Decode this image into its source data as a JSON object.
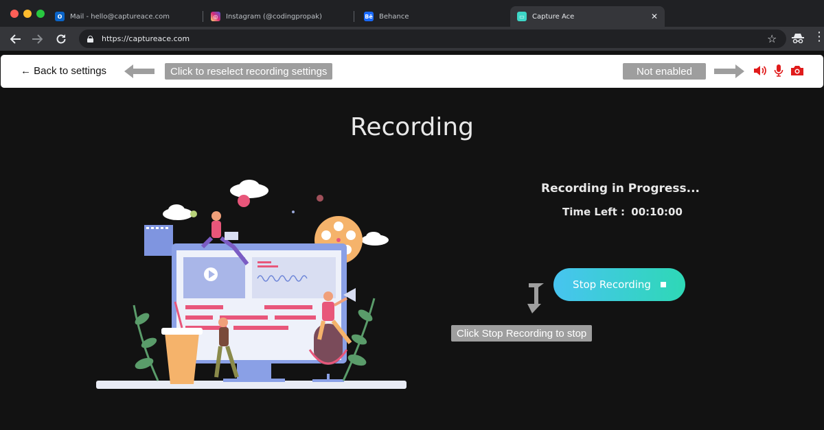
{
  "browser": {
    "tabs": [
      {
        "label": "Mail - hello@captureace.com",
        "favicon": "outlook-icon",
        "color": "#0a64c8"
      },
      {
        "label": "Instagram (@codingpropak)",
        "favicon": "instagram-icon",
        "color": "#d62976"
      },
      {
        "label": "Behance",
        "favicon": "behance-icon",
        "color": "#1769ff"
      },
      {
        "label": "Capture Ace",
        "favicon": "captureace-icon",
        "color": "#3dd6c6",
        "active": true
      }
    ],
    "url": "https://captureace.com"
  },
  "appbar": {
    "back_label": "← Back to settings",
    "reselect_hint": "Click to reselect recording settings",
    "not_enabled_hint": "Not enabled",
    "status_icons": [
      "speaker-icon",
      "microphone-icon",
      "camera-icon"
    ],
    "status_color": "#e01b1b"
  },
  "main": {
    "title": "Recording",
    "progress_text": "Recording in Progress...",
    "time_left_label": "Time Left :",
    "time_left_value": "00:10:00",
    "stop_label": "Stop Recording",
    "stop_hint": "Click Stop Recording to stop"
  },
  "colors": {
    "accent_start": "#47c4f0",
    "accent_end": "#2ed8b6",
    "hint_bg": "#9e9e9e"
  }
}
